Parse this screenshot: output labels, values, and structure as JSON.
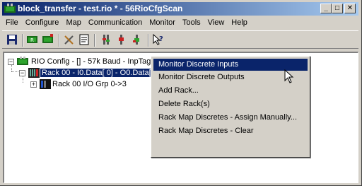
{
  "window": {
    "title": "block_transfer - test.rio * - 56RioCfgScan",
    "controls": [
      "_",
      "□",
      "✕"
    ]
  },
  "menubar": {
    "items": [
      "File",
      "Configure",
      "Map",
      "Communication",
      "Monitor",
      "Tools",
      "View",
      "Help"
    ]
  },
  "toolbar": {
    "icons": [
      "save-icon",
      "configure-icon",
      "configure-alt-icon",
      "tools-icon",
      "document-icon",
      "io-point-icon",
      "io-point-red-icon",
      "io-point-green-icon",
      "help-pointer-icon"
    ]
  },
  "tree": {
    "root": {
      "label": "RIO Config - [] - 57k Baud - InpTags:1 OutTags:1",
      "expander": "−"
    },
    "rack": {
      "label": "Rack 00 - I0.Data[ 0] - O0.Data[ 0]",
      "expander": "−"
    },
    "group": {
      "label": "Rack 00 I/O Grp 0->3",
      "expander": "+"
    }
  },
  "context_menu": {
    "items": [
      "Monitor Discrete Inputs",
      "Monitor Discrete Outputs",
      "Add Rack...",
      "Delete Rack(s)",
      "Rack Map Discretes - Assign Manually...",
      "Rack Map Discretes - Clear"
    ],
    "highlighted_index": 0
  },
  "colors": {
    "selection": "#0a246a",
    "chrome": "#d4d0c8"
  }
}
